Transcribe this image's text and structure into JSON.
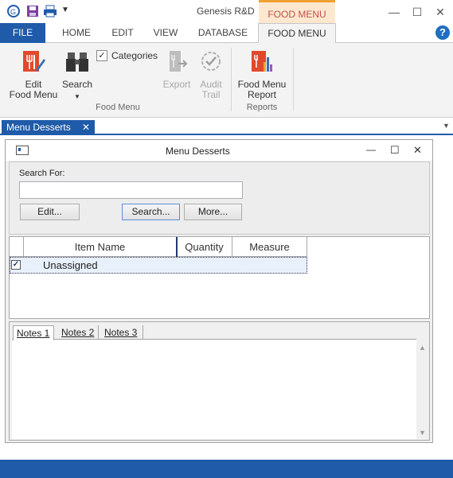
{
  "app": {
    "title": "Genesis R&D",
    "context_header": "FOOD MENU"
  },
  "ribbon_tabs": {
    "file": "FILE",
    "home": "HOME",
    "edit": "EDIT",
    "view": "VIEW",
    "database": "DATABASE",
    "food_menu": "FOOD MENU"
  },
  "ribbon": {
    "edit_food_menu": {
      "line1": "Edit",
      "line2": "Food Menu"
    },
    "search": {
      "label": "Search"
    },
    "categories": {
      "label": "Categories",
      "checked": true
    },
    "export": {
      "label": "Export"
    },
    "audit_trail": {
      "line1": "Audit",
      "line2": "Trail"
    },
    "food_menu_report": {
      "line1": "Food Menu",
      "line2": "Report"
    },
    "group_food_menu": "Food Menu",
    "group_reports": "Reports"
  },
  "doc_tab": {
    "prefix": "Menu",
    "name": "Desserts",
    "close": "✕"
  },
  "inner_window": {
    "title_prefix": "Menu",
    "title_name": "Desserts"
  },
  "search_panel": {
    "label": "Search For:",
    "value": "",
    "buttons": {
      "edit": "Edit...",
      "search": "Search...",
      "more": "More..."
    }
  },
  "grid": {
    "headers": [
      "Item Name",
      "Quantity",
      "Measure"
    ],
    "rows": [
      {
        "checked": true,
        "item_name": "Unassigned",
        "quantity": "",
        "measure": ""
      }
    ]
  },
  "notes_tabs": [
    "Notes 1",
    "Notes 2",
    "Notes 3"
  ],
  "colors": {
    "accent": "#1f5ba8",
    "context": "#f0a030",
    "context_text": "#c0504d"
  }
}
